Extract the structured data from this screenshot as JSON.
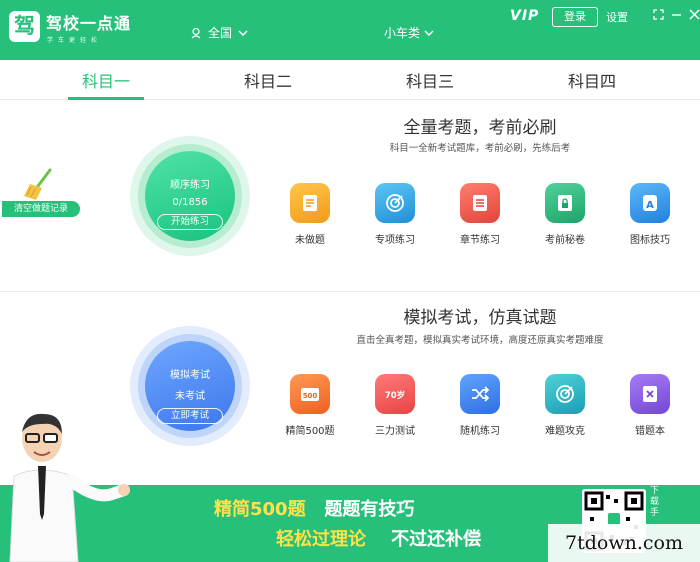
{
  "header": {
    "logo_glyph": "驾",
    "app_title": "驾校一点通",
    "app_subtitle": "学车更轻松",
    "region": "全国",
    "car_type": "小车类",
    "vip": "VIP",
    "login": "登录",
    "settings": "设置"
  },
  "tabs": [
    {
      "label": "科目一",
      "active": true
    },
    {
      "label": "科目二"
    },
    {
      "label": "科目三"
    },
    {
      "label": "科目四"
    }
  ],
  "practice": {
    "title": "全量考题，考前必刷",
    "subtitle": "科目一全新考试题库，考前必刷，先练后考",
    "circle": {
      "label": "顺序练习",
      "progress": "0/1856",
      "button": "开始练习"
    },
    "clear_record": "清空做题记录",
    "features": [
      {
        "label": "未做题",
        "icon": "document-icon",
        "color": "#f5a623"
      },
      {
        "label": "专项练习",
        "icon": "target-icon",
        "color": "#2fa8e0"
      },
      {
        "label": "章节练习",
        "icon": "list-icon",
        "color": "#ef5a4c"
      },
      {
        "label": "考前秘卷",
        "icon": "lock-book-icon",
        "color": "#2fb878"
      },
      {
        "label": "图标技巧",
        "icon": "letter-a-icon",
        "color": "#2f9ee8"
      }
    ]
  },
  "exam": {
    "title": "模拟考试，仿真试题",
    "subtitle": "直击全真考题，模拟真实考试环境，高度还原真实考题难度",
    "circle": {
      "label": "模拟考试",
      "status": "未考试",
      "button": "立即考试"
    },
    "features": [
      {
        "label": "精简500题",
        "icon": "500-icon",
        "badge": "500",
        "color": "#f47a3a"
      },
      {
        "label": "三力测试",
        "icon": "70-age-icon",
        "badge": "70岁",
        "color": "#f25a5a"
      },
      {
        "label": "随机练习",
        "icon": "shuffle-icon",
        "color": "#3a8ef0"
      },
      {
        "label": "难题攻克",
        "icon": "target-icon",
        "color": "#2cb5c8"
      },
      {
        "label": "错题本",
        "icon": "error-book-icon",
        "color": "#8a5ce0"
      }
    ]
  },
  "banner": {
    "line1_a": "精简500题",
    "line1_b": "题题有技巧",
    "line2_a": "轻松过理论",
    "line2_b": "不过还补偿",
    "download": "下载手",
    "watermark": "7tdown.com"
  }
}
